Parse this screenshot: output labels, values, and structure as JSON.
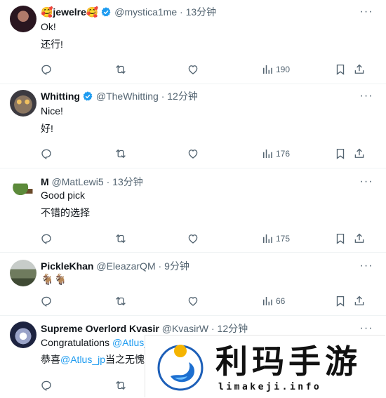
{
  "tweets": [
    {
      "display_name": "🥰jewelre🥰",
      "handle": "@mystica1me",
      "time": "13分钟",
      "verified": true,
      "lines": [
        "Ok!",
        "还行!"
      ],
      "views": "190",
      "avatar_color": "#3a1f2e"
    },
    {
      "display_name": "Whitting",
      "handle": "@TheWhitting",
      "time": "12分钟",
      "verified": true,
      "lines": [
        "Nice!",
        "好!"
      ],
      "views": "176",
      "avatar_color": "#6b5a4a"
    },
    {
      "display_name": "M",
      "handle": "@MatLewi5",
      "time": "13分钟",
      "verified": false,
      "lines": [
        "Good pick",
        "不错的选择"
      ],
      "views": "175",
      "avatar_color": "#4b7a3a"
    },
    {
      "display_name": "PickleKhan",
      "handle": "@EleazarQM",
      "time": "9分钟",
      "verified": false,
      "lines": [
        "🐐🐐"
      ],
      "views": "66",
      "avatar_color": "#7c8a6a"
    },
    {
      "display_name": "Supreme Overlord Kvasir",
      "handle": "@KvasirW",
      "time": "12分钟",
      "verified": false,
      "line1_prefix": "Congratulations ",
      "line1_link": "@Atlus_",
      "line2_prefix": "恭喜",
      "line2_link": "@Atlus_jp",
      "line2_suffix": "当之无愧",
      "avatar_color": "#c9cfe0"
    }
  ],
  "separator": "·",
  "more_label": "···",
  "watermark": {
    "title": "利玛手游",
    "url": "limakeji.info"
  },
  "colors": {
    "accent": "#1d9bf0",
    "muted": "#536471",
    "text": "#0f1419"
  }
}
